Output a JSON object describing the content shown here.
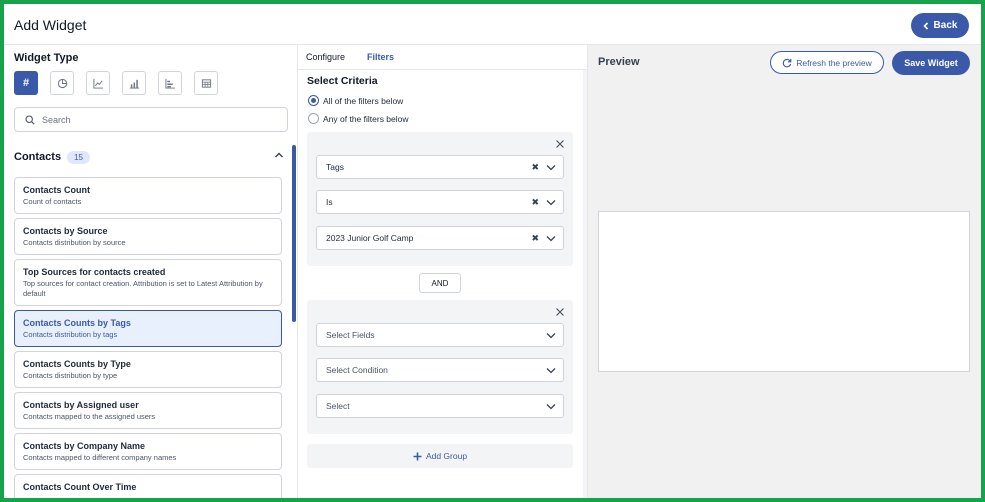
{
  "header": {
    "title": "Add Widget",
    "back_label": "Back"
  },
  "widget_type": {
    "label": "Widget Type",
    "active_symbol": "#",
    "types": [
      {
        "icon": "hash-icon"
      },
      {
        "icon": "pie-chart-icon"
      },
      {
        "icon": "line-chart-icon"
      },
      {
        "icon": "bar-chart-icon"
      },
      {
        "icon": "horizontal-bar-chart-icon"
      },
      {
        "icon": "table-icon"
      }
    ]
  },
  "search": {
    "placeholder": "Search"
  },
  "section": {
    "name": "Contacts",
    "count": "15"
  },
  "widgets": [
    {
      "title": "Contacts Count",
      "desc": "Count of contacts"
    },
    {
      "title": "Contacts by Source",
      "desc": "Contacts distribution by source"
    },
    {
      "title": "Top Sources for contacts created",
      "desc": "Top sources for contact creation. Attribution is set to Latest Attribution by default"
    },
    {
      "title": "Contacts Counts by Tags",
      "desc": "Contacts distribution by tags"
    },
    {
      "title": "Contacts Counts by Type",
      "desc": "Contacts distribution by type"
    },
    {
      "title": "Contacts by Assigned user",
      "desc": "Contacts mapped to the assigned users"
    },
    {
      "title": "Contacts by Company Name",
      "desc": "Contacts mapped to different company names"
    },
    {
      "title": "Contacts Count Over Time",
      "desc": ""
    }
  ],
  "tabs": {
    "configure": "Configure",
    "filters": "Filters"
  },
  "criteria": {
    "title": "Select Criteria",
    "all": "All of the filters below",
    "any": "Any of the filters below"
  },
  "group1": {
    "field": "Tags",
    "condition": "Is",
    "value": "2023 Junior Golf Camp"
  },
  "and_label": "AND",
  "group2": {
    "field": "Select Fields",
    "condition": "Select Condition",
    "value": "Select"
  },
  "add_group": "Add Group",
  "preview": {
    "title": "Preview",
    "refresh": "Refresh the preview",
    "save": "Save Widget"
  },
  "colors": {
    "accent": "#3a5aa9",
    "frame": "#16a34a"
  }
}
